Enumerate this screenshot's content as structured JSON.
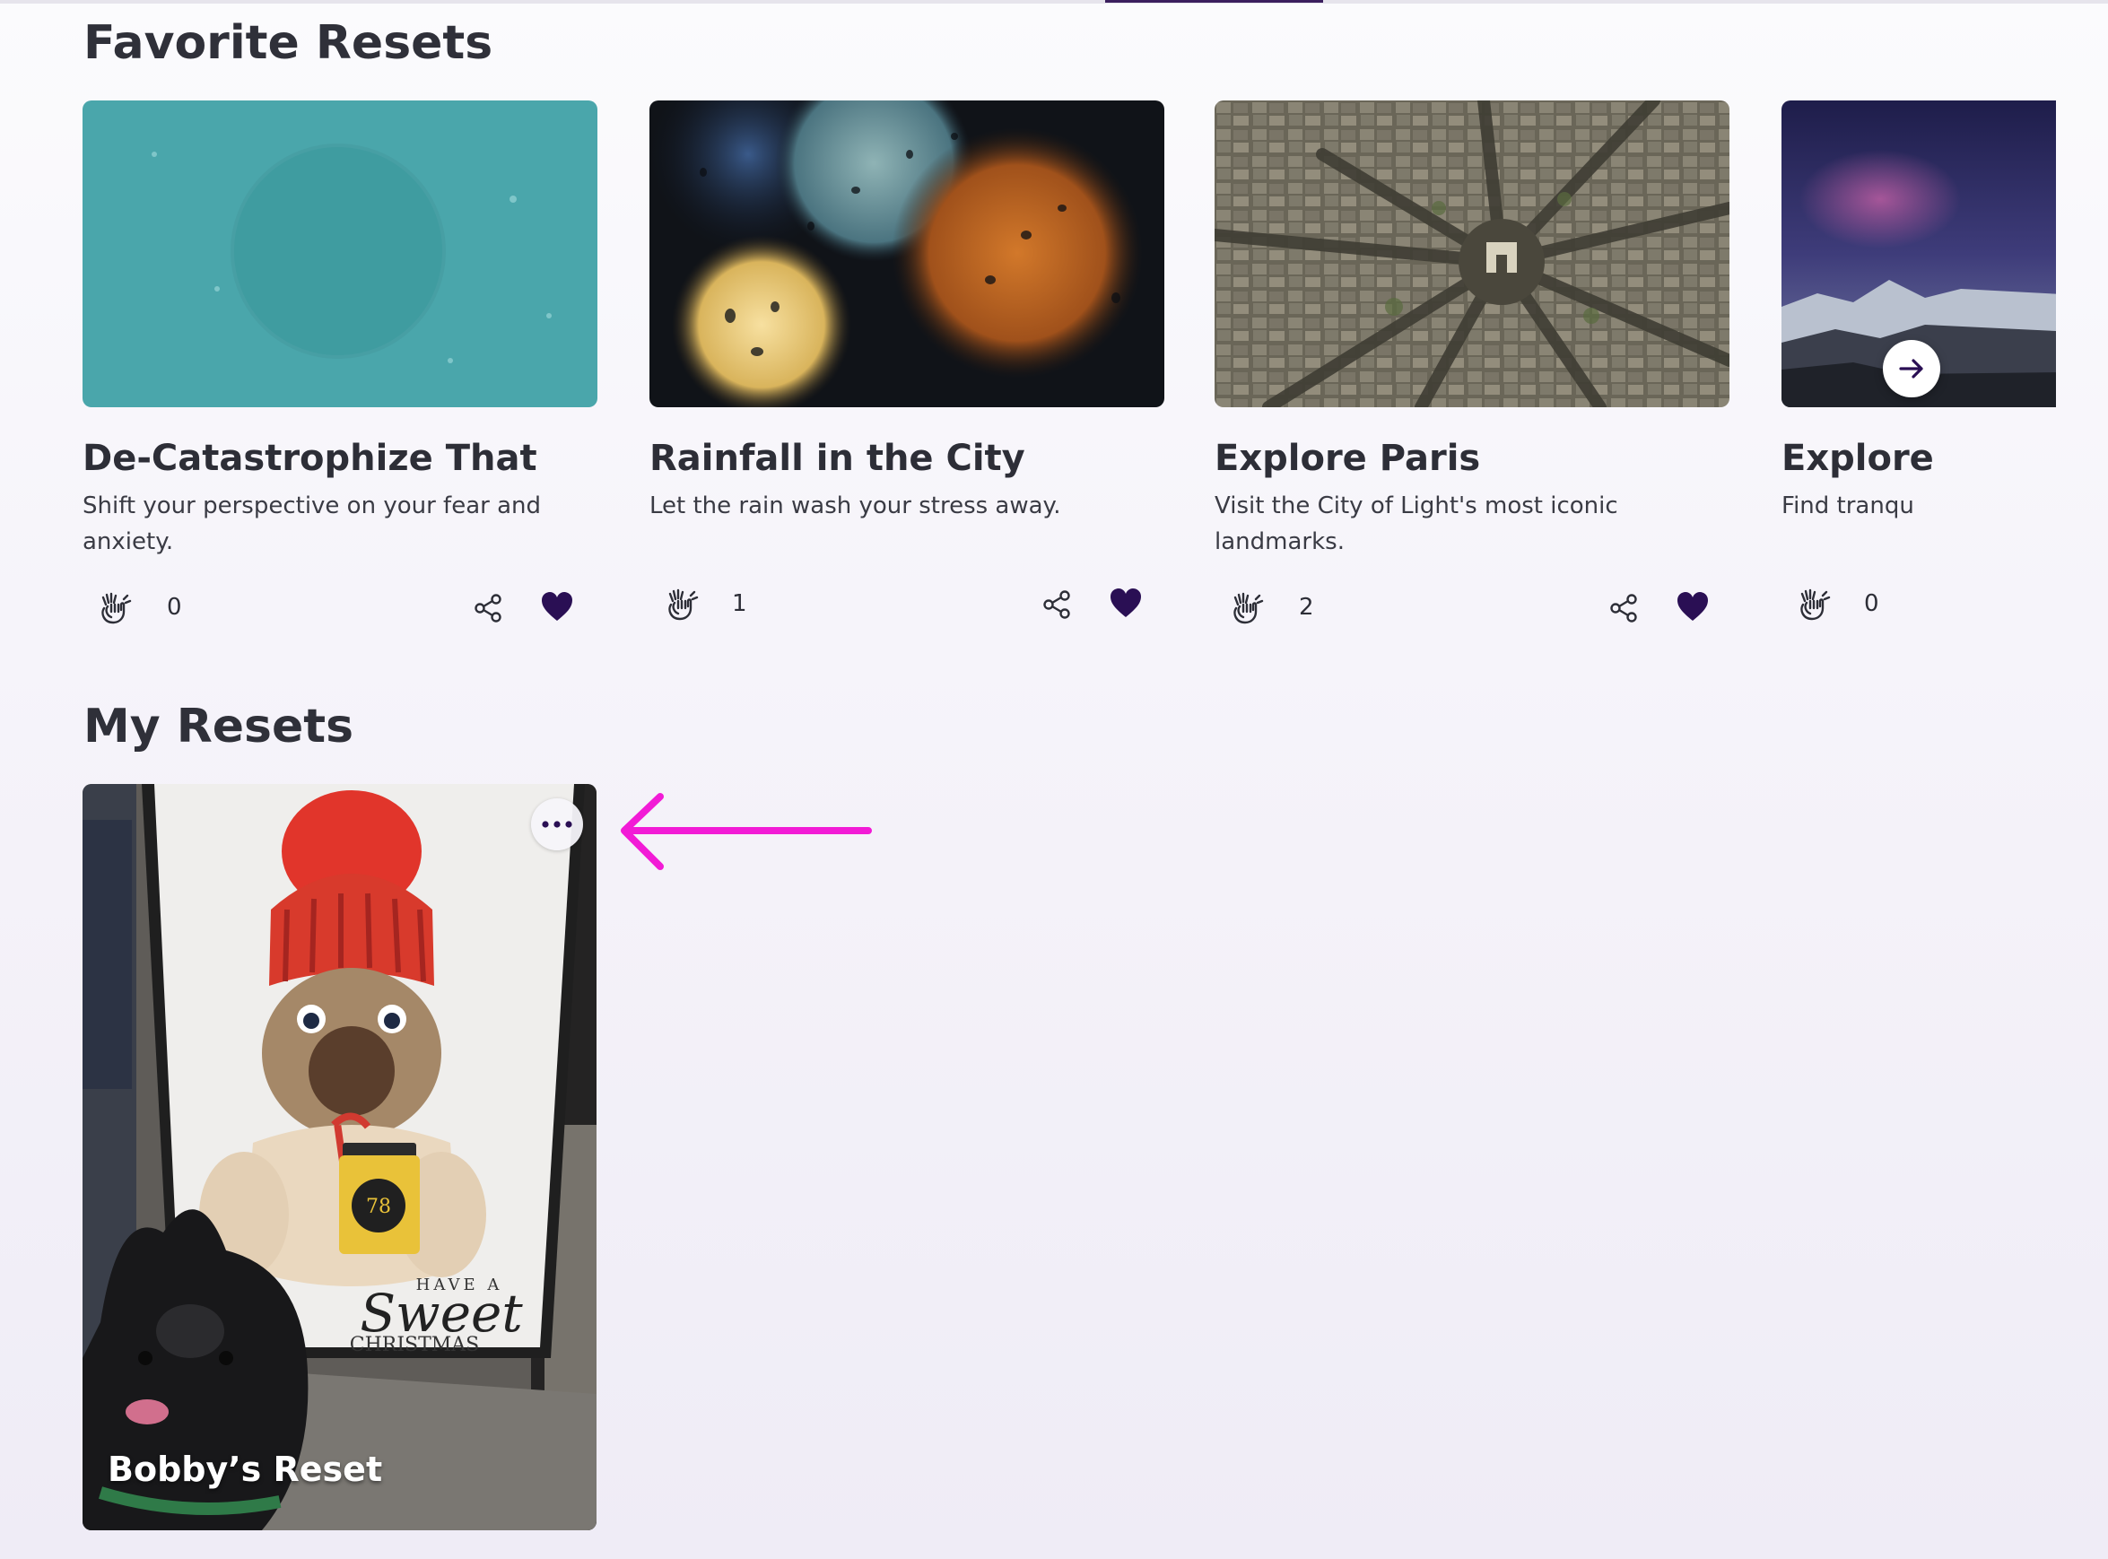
{
  "favorites": {
    "title": "Favorite Resets",
    "cards": [
      {
        "title": "De-Catastrophize That",
        "description": "Shift your perspective on your fear and anxiety.",
        "claps": "0"
      },
      {
        "title": "Rainfall in the City",
        "description": "Let the rain wash your stress away.",
        "claps": "1"
      },
      {
        "title": "Explore Paris",
        "description": "Visit the City of Light's most iconic landmarks.",
        "claps": "2"
      },
      {
        "title": "Explore",
        "description": "Find tranqu",
        "claps": "0"
      }
    ]
  },
  "my_resets": {
    "title": "My Resets",
    "cards": [
      {
        "label": "Bobby’s Reset"
      }
    ]
  },
  "icons": {
    "clap": "clap-icon",
    "share": "share-icon",
    "heart": "heart-icon",
    "next": "arrow-right-icon",
    "more": "more-dots-icon"
  },
  "colors": {
    "accent": "#2a0f54",
    "annotation": "#f21bd6",
    "teal_card": "#4aa6ab"
  }
}
